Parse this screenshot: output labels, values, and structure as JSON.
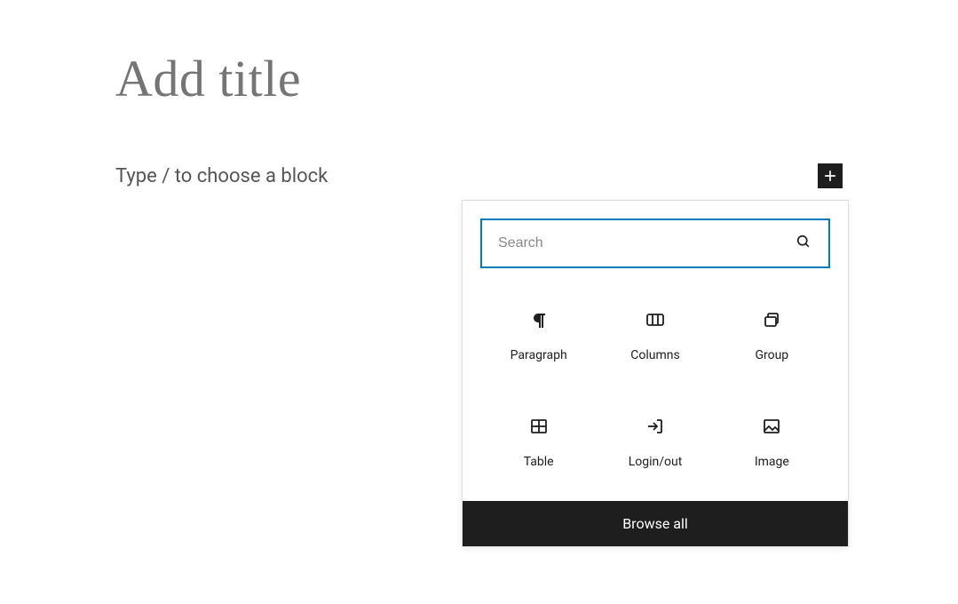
{
  "editor": {
    "title_placeholder": "Add title",
    "content_placeholder": "Type / to choose a block"
  },
  "inserter": {
    "search_placeholder": "Search",
    "browse_all_label": "Browse all",
    "blocks": [
      {
        "label": "Paragraph",
        "icon": "paragraph"
      },
      {
        "label": "Columns",
        "icon": "columns"
      },
      {
        "label": "Group",
        "icon": "group"
      },
      {
        "label": "Table",
        "icon": "table"
      },
      {
        "label": "Login/out",
        "icon": "login"
      },
      {
        "label": "Image",
        "icon": "image"
      }
    ]
  }
}
